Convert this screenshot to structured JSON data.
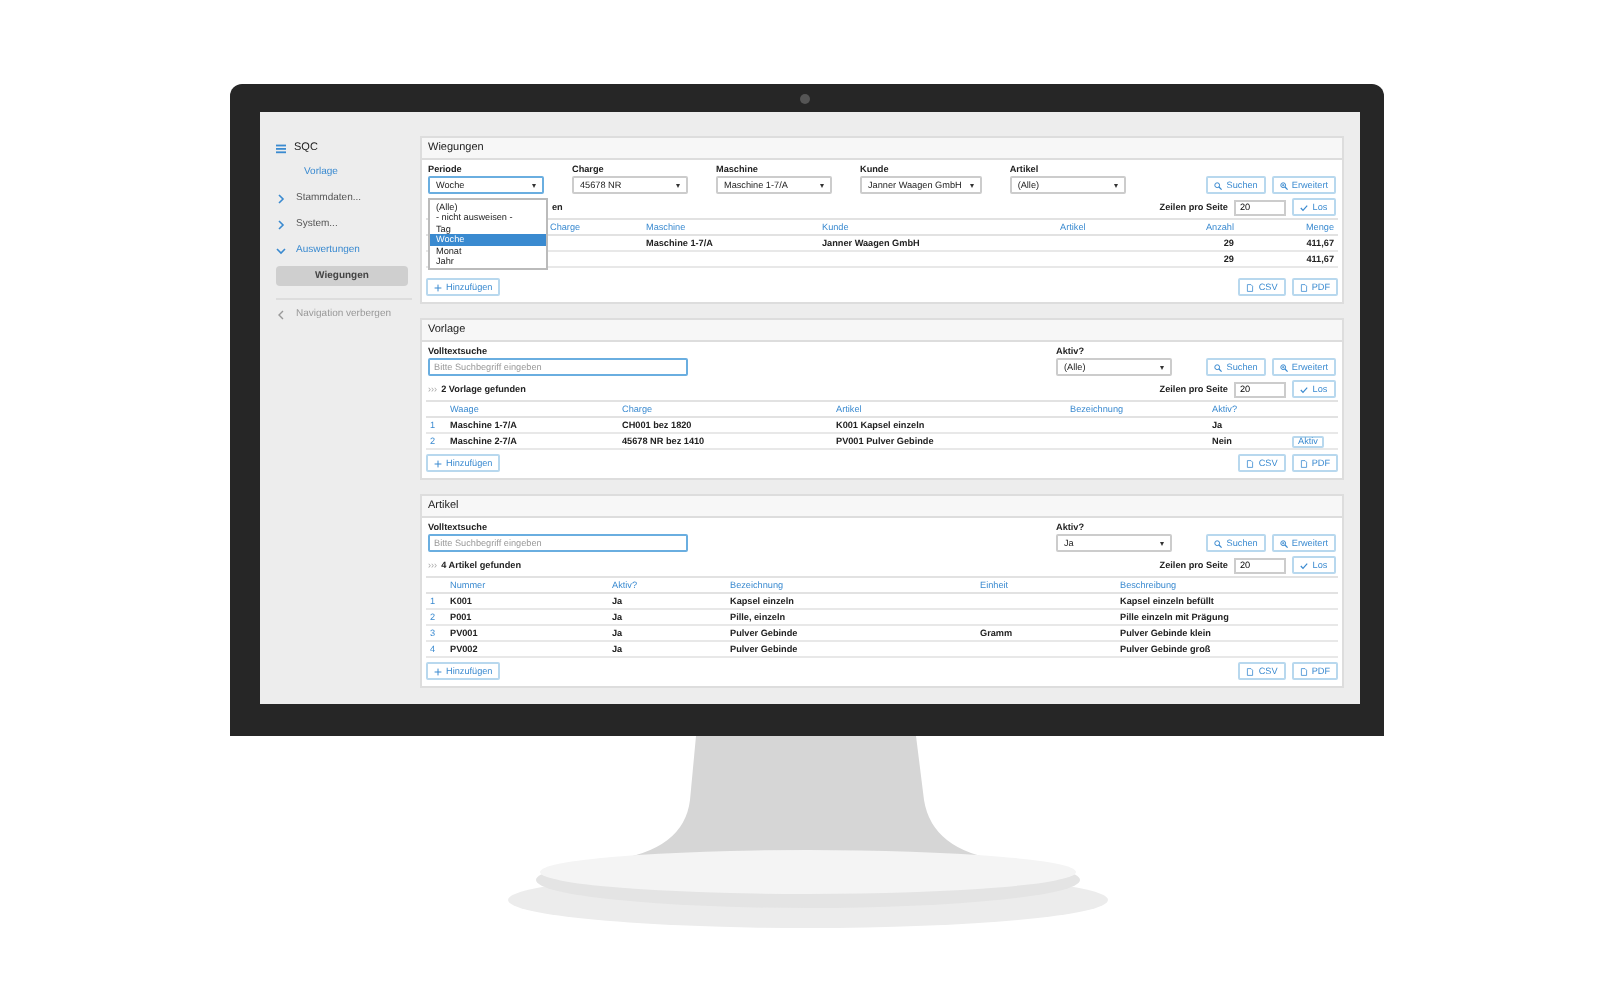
{
  "sidebar": {
    "items": [
      {
        "label": "SQC",
        "kind": "brand"
      },
      {
        "label": "Vorlage",
        "kind": "link"
      },
      {
        "label": "Stammdaten...",
        "kind": "group",
        "expanded": false
      },
      {
        "label": "System...",
        "kind": "group",
        "expanded": false
      },
      {
        "label": "Auswertungen",
        "kind": "group",
        "expanded": true,
        "children": [
          {
            "label": "Wiegungen",
            "selected": true
          }
        ]
      }
    ],
    "collapse": "Navigation verbergen"
  },
  "sections": [
    {
      "title": "Wiegungen",
      "filters": [
        {
          "kind": "select",
          "label": "Periode",
          "value": "Woche",
          "options": [
            {
              "label": "(Alle)",
              "selected": false
            },
            {
              "label": "- nicht ausweisen -",
              "selected": false
            },
            {
              "label": "Tag",
              "selected": false
            },
            {
              "label": "Woche",
              "selected": true
            },
            {
              "label": "Monat",
              "selected": false
            },
            {
              "label": "Jahr",
              "selected": false
            }
          ]
        },
        {
          "kind": "select",
          "label": "Charge",
          "value": "45678 NR"
        },
        {
          "kind": "select",
          "label": "Maschine",
          "value": "Maschine 1-7/A"
        },
        {
          "kind": "select",
          "label": "Kunde",
          "value": "Janner Waagen GmbH"
        },
        {
          "kind": "select",
          "label": "Artikel",
          "value": "(Alle)"
        }
      ],
      "buttons": [
        "Suchen",
        "Erweitert"
      ],
      "count": "en",
      "rows_label": "Zeilen pro Seite",
      "rows_value": "20",
      "go": "Los",
      "columns": [
        "Charge",
        "Maschine",
        "Kunde",
        "Artikel",
        "Anzahl",
        "Menge"
      ],
      "rows": [
        {
          "cells": [
            null,
            "Maschine 1-7/A",
            "Janner Waagen GmbH",
            null,
            "29",
            "411,67"
          ]
        }
      ],
      "total": [
        "29",
        "411,67"
      ],
      "add": "Hinzufügen",
      "exports": [
        "CSV",
        "PDF"
      ]
    },
    {
      "title": "Vorlage",
      "filters": [
        {
          "kind": "search",
          "label": "Volltextsuche",
          "placeholder": "Bitte Suchbegriff eingeben"
        },
        {
          "kind": "select",
          "label": "Aktiv?",
          "value": "(Alle)"
        }
      ],
      "buttons": [
        "Suchen",
        "Erweitert"
      ],
      "count_marker": "›››",
      "count": "2 Vorlage gefunden",
      "rows_label": "Zeilen pro Seite",
      "rows_value": "20",
      "go": "Los",
      "columns": [
        "Waage",
        "Charge",
        "Artikel",
        "Bezeichnung",
        "Aktiv?"
      ],
      "rows": [
        {
          "number": "1",
          "cells": [
            "Maschine 1-7/A",
            "CH001 bez 1820",
            "K001 Kapsel einzeln",
            null,
            "Ja"
          ]
        },
        {
          "number": "2",
          "cells": [
            "Maschine 2-7/A",
            "45678 NR bez 1410",
            "PV001 Pulver Gebinde",
            null,
            "Nein"
          ],
          "action": "Aktiv"
        }
      ],
      "add": "Hinzufügen",
      "exports": [
        "CSV",
        "PDF"
      ]
    },
    {
      "title": "Artikel",
      "filters": [
        {
          "kind": "search",
          "label": "Volltextsuche",
          "placeholder": "Bitte Suchbegriff eingeben"
        },
        {
          "kind": "select",
          "label": "Aktiv?",
          "value": "Ja"
        }
      ],
      "buttons": [
        "Suchen",
        "Erweitert"
      ],
      "count_marker": "›››",
      "count": "4 Artikel gefunden",
      "rows_label": "Zeilen pro Seite",
      "rows_value": "20",
      "go": "Los",
      "columns": [
        "Nummer",
        "Aktiv?",
        "Bezeichnung",
        "Einheit",
        "Beschreibung"
      ],
      "rows": [
        {
          "number": "1",
          "cells": [
            "K001",
            "Ja",
            "Kapsel einzeln",
            null,
            "Kapsel einzeln befüllt"
          ]
        },
        {
          "number": "2",
          "cells": [
            "P001",
            "Ja",
            "Pille, einzeln",
            null,
            "Pille einzeln mit Prägung"
          ]
        },
        {
          "number": "3",
          "cells": [
            "PV001",
            "Ja",
            "Pulver Gebinde",
            "Gramm",
            "Pulver Gebinde klein"
          ]
        },
        {
          "number": "4",
          "cells": [
            "PV002",
            "Ja",
            "Pulver Gebinde",
            null,
            "Pulver Gebinde groß"
          ]
        }
      ],
      "add": "Hinzufügen",
      "exports": [
        "CSV",
        "PDF"
      ]
    }
  ]
}
